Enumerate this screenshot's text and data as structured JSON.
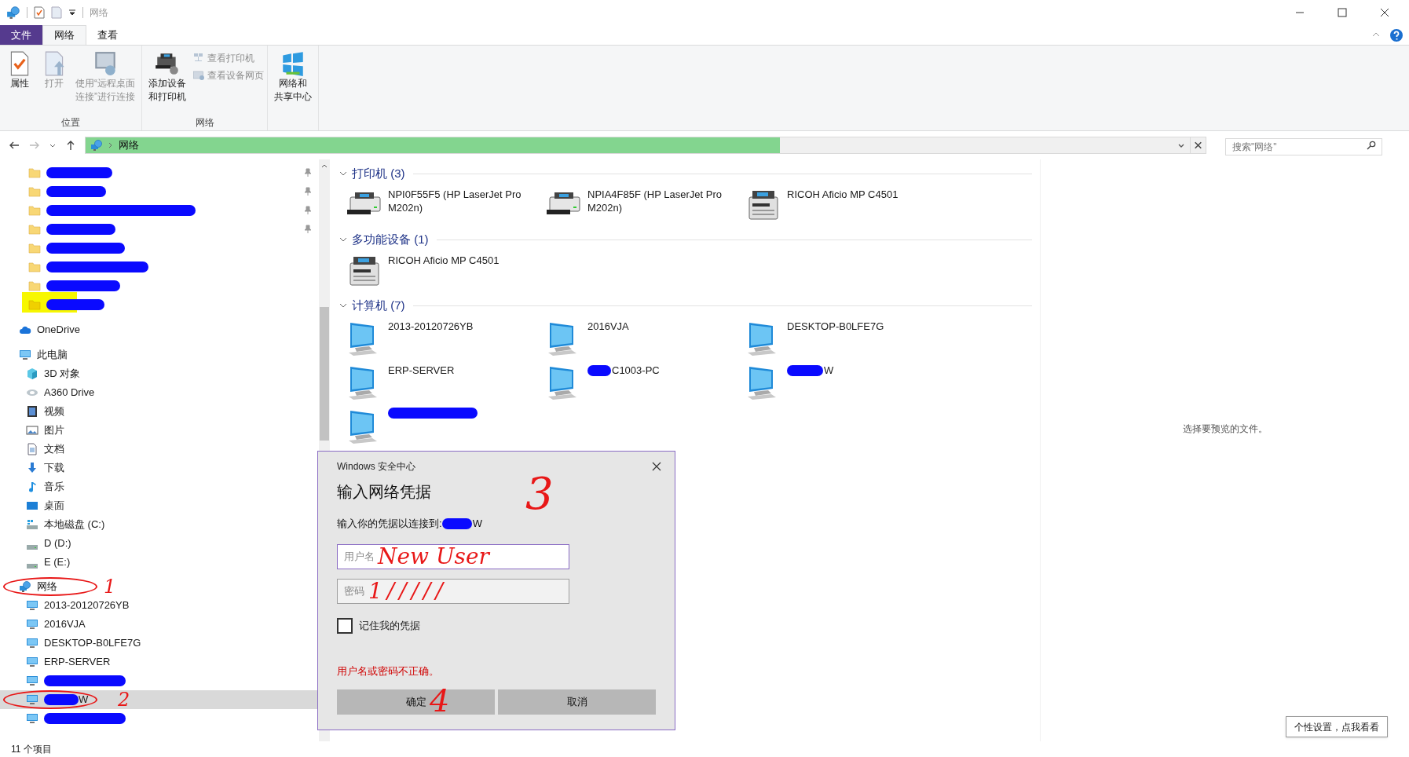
{
  "title_bar": {
    "title": "网络"
  },
  "ribbon": {
    "tabs": [
      {
        "label": "文件",
        "kind": "file",
        "selected": false
      },
      {
        "label": "网络",
        "kind": "tab",
        "selected": true
      },
      {
        "label": "查看",
        "kind": "tab",
        "selected": false
      }
    ],
    "groups": [
      {
        "label": "位置",
        "buttons": [
          {
            "lines": [
              "属性"
            ],
            "disabled": false
          },
          {
            "lines": [
              "打开"
            ],
            "disabled": true
          },
          {
            "lines": [
              "使用“远程桌面",
              "连接”进行连接"
            ],
            "disabled": true
          }
        ]
      },
      {
        "label": "网络",
        "buttons": [
          {
            "lines": [
              "添加设备",
              "和打印机"
            ],
            "disabled": false
          },
          {
            "lines": [
              "查看打印机"
            ],
            "disabled": true,
            "kind": "small"
          },
          {
            "lines": [
              "查看设备网页"
            ],
            "disabled": true,
            "kind": "small"
          }
        ]
      },
      {
        "buttons": [
          {
            "lines": [
              "网络和",
              "共享中心"
            ],
            "disabled": false
          }
        ]
      }
    ]
  },
  "address": {
    "path": "网络",
    "level": 0.62,
    "search_placeholder": "搜索\"网络\""
  },
  "nav": {
    "quick_access": [
      {
        "redacted": true,
        "pinned": true
      },
      {
        "redacted": true,
        "pinned": true
      },
      {
        "redacted": true,
        "pinned": true
      },
      {
        "redacted": true,
        "pinned": true
      },
      {
        "redacted": true,
        "pinned": false
      },
      {
        "redacted": true,
        "pinned": false
      },
      {
        "redacted": true,
        "pinned": false
      },
      {
        "redacted": true,
        "pinned": false,
        "highlighted": true
      }
    ],
    "onedrive": {
      "label": "OneDrive"
    },
    "this_pc": {
      "label": "此电脑",
      "children": [
        {
          "label": "3D 对象"
        },
        {
          "label": "A360 Drive"
        },
        {
          "label": "视频"
        },
        {
          "label": "图片"
        },
        {
          "label": "文档"
        },
        {
          "label": "下载"
        },
        {
          "label": "音乐"
        },
        {
          "label": "桌面"
        },
        {
          "label": "本地磁盘 (C:)"
        },
        {
          "label": "D (D:)"
        },
        {
          "label": "E (E:)"
        }
      ]
    },
    "network": {
      "label": "网络",
      "circled": true,
      "children": [
        {
          "label": "2013-20120726YB",
          "selected": false,
          "circled": false
        },
        {
          "label": "2016VJA",
          "selected": false,
          "circled": false
        },
        {
          "label": "DESKTOP-B0LFE7G",
          "selected": false,
          "circled": false
        },
        {
          "label": "ERP-SERVER",
          "selected": false,
          "circled": false
        },
        {
          "redacted": true,
          "selected": false,
          "circled": false
        },
        {
          "label": "W",
          "redacted": true,
          "selected": true,
          "circled": true
        },
        {
          "redacted": true,
          "selected": false,
          "circled": false
        }
      ]
    }
  },
  "groups": [
    {
      "title": "打印机 (3)",
      "items": [
        {
          "kind": "printer",
          "lines": [
            "NPI0F55F5 (HP LaserJet Pro",
            "M202n)"
          ]
        },
        {
          "kind": "printer",
          "lines": [
            "NPIA4F85F (HP LaserJet Pro",
            "M202n)"
          ]
        },
        {
          "kind": "mfp",
          "lines": [
            "RICOH Aficio MP C4501"
          ]
        }
      ]
    },
    {
      "title": "多功能设备 (1)",
      "items": [
        {
          "kind": "mfp",
          "lines": [
            "RICOH Aficio MP C4501"
          ]
        }
      ]
    },
    {
      "title": "计算机 (7)",
      "items": [
        {
          "kind": "computer",
          "lines": [
            "2013-20120726YB"
          ]
        },
        {
          "kind": "computer",
          "lines": [
            "2016VJA"
          ]
        },
        {
          "kind": "computer",
          "lines": [
            "DESKTOP-B0LFE7G"
          ]
        },
        {
          "kind": "computer",
          "lines": [
            "ERP-SERVER"
          ]
        },
        {
          "kind": "computer",
          "lines": [
            "C1003-PC"
          ],
          "redacted": true
        },
        {
          "kind": "computer",
          "lines": [
            "W"
          ],
          "redacted": true
        },
        {
          "kind": "computer",
          "redacted": true
        }
      ]
    }
  ],
  "preview": {
    "message": "选择要预览的文件。"
  },
  "status_bar": {
    "count": "11 个项目"
  },
  "dialog": {
    "caption": "Windows 安全中心",
    "heading": "输入网络凭据",
    "prompt": "输入你的凭据以连接到:",
    "target": "W",
    "username": {
      "placeholder": "用户名",
      "scribble": "New User"
    },
    "password": {
      "placeholder": "密码",
      "scribble": "1/////"
    },
    "remember": {
      "label": "记住我的凭据",
      "checked": false
    },
    "error": "用户名或密码不正确。",
    "buttons": [
      "确定",
      "取消"
    ]
  },
  "annotations": [
    "1",
    "2",
    "3",
    "4"
  ],
  "tooltip": "个性设置，点我看看"
}
